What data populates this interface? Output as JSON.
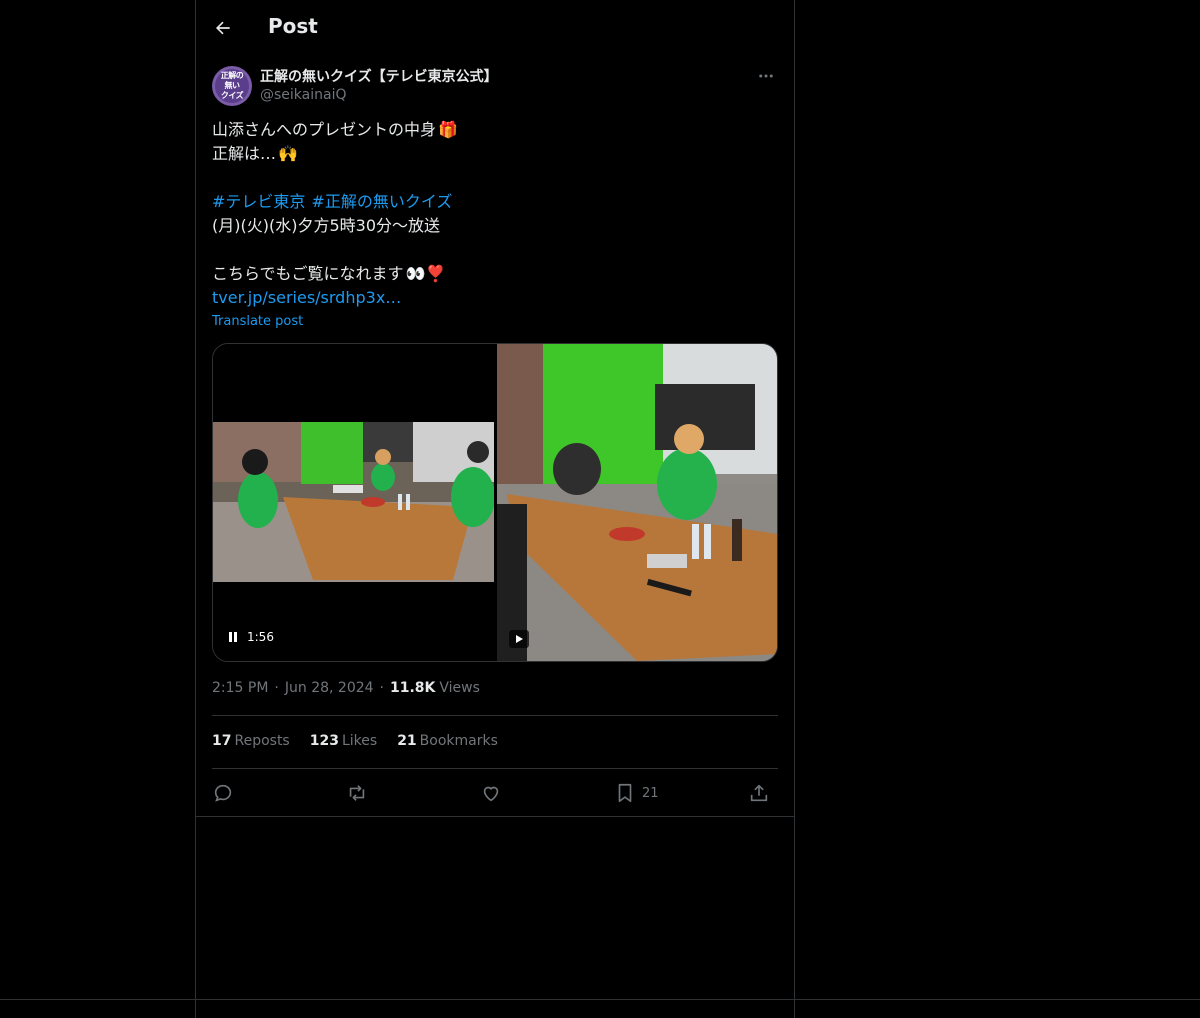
{
  "header": {
    "title": "Post"
  },
  "author": {
    "display_name": "正解の無いクイズ【テレビ東京公式】",
    "handle": "@seikainaiQ",
    "avatar_lines": [
      "正解の",
      "無い",
      "クイズ"
    ]
  },
  "post": {
    "line1": "山添さんへのプレゼントの中身",
    "line1_emoji": "🎁",
    "line2": "正解は…",
    "line2_emoji": "🙌",
    "hashtag1": "#テレビ東京",
    "hashtag2": "#正解の無いクイズ",
    "line4": "(月)(火)(水)夕方5時30分〜放送",
    "line5": "こちらでもご覧になれます",
    "line5_emoji": "👀❣️",
    "link": "tver.jp/series/srdhp3x…"
  },
  "translate_label": "Translate post",
  "media": {
    "left_duration": "1:56"
  },
  "meta": {
    "time": "2:15 PM",
    "date": "Jun 28, 2024",
    "views_count": "11.8K",
    "views_label": "Views",
    "dot": "·"
  },
  "stats": {
    "reposts_count": "17",
    "reposts_label": "Reposts",
    "likes_count": "123",
    "likes_label": "Likes",
    "bookmarks_count": "21",
    "bookmarks_label": "Bookmarks"
  },
  "actions": {
    "bookmark_count": "21"
  },
  "icons": [
    "back-arrow-icon",
    "more-icon",
    "pause-icon",
    "play-icon",
    "reply-icon",
    "repost-icon",
    "like-icon",
    "bookmark-icon",
    "share-icon"
  ],
  "colors": {
    "background": "#000000",
    "text": "#e7e9ea",
    "muted": "#71767b",
    "accent": "#1d9bf0",
    "border": "#2f3336"
  }
}
